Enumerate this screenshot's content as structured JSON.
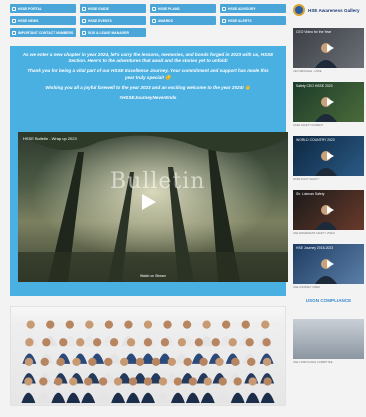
{
  "nav_buttons": [
    {
      "label": "HSSE PORTAL"
    },
    {
      "label": "HSSE GUIDE"
    },
    {
      "label": "HSSE PLANS"
    },
    {
      "label": "HSSE ADVISORY"
    },
    {
      "label": "HSSE NEWS"
    },
    {
      "label": "HSSE EVENTS"
    },
    {
      "label": "AWARDS"
    },
    {
      "label": "HSSE ALERTS"
    },
    {
      "label": "IMPORTANT CONTACT NUMBERS"
    },
    {
      "label": "SOS & LEAVE MANAGER"
    }
  ],
  "banner": {
    "paragraphs": [
      "As we enter a new chapter in year 2024, let's carry the lessons, memories, and bonds forged in 2023 with us, HSSE Section. Here's to the adventures that await and the stories yet to unfold!",
      "Thank you for being a vital part of our HSSE Excellence Journey. Your commitment and support has made this year truly special! 😊",
      "Wishing you all a joyful farewell to the year 2023 and an exciting welcome to the year 2024! 👋",
      "#HSSEJourneyNeverEnds"
    ]
  },
  "video": {
    "title": "HSSE Bulletin - Wrap up 2023",
    "overlay_text": "Bulletin",
    "caption": "Watch on Stream"
  },
  "logo": {
    "text": "HSE Awareness Gallery"
  },
  "side_videos": [
    {
      "title": "CEO Video for the Year",
      "sub": "CEO MESSAGE - HSSE"
    },
    {
      "title": "Safety CEO HSSE 2023",
      "sub": "HSSE SAFETY MOMENT"
    },
    {
      "title": "WORLD COUNTRY 2023",
      "sub": "WORLD DAY SAFETY"
    },
    {
      "title": "Sir. Lokman Safety",
      "sub": "HSE AWARENESS SAFETY VIDEO"
    },
    {
      "title": "HSE Journey 2018-2023",
      "sub": "HSE JOURNEY VIDEO"
    }
  ],
  "us_compliance": {
    "title": "USGN COMPLIANCE",
    "sub": "HSE COMPLIANCE COMMITTEE"
  },
  "colors": {
    "accent": "#4ab0e2",
    "nav": "#4aa6d8"
  }
}
